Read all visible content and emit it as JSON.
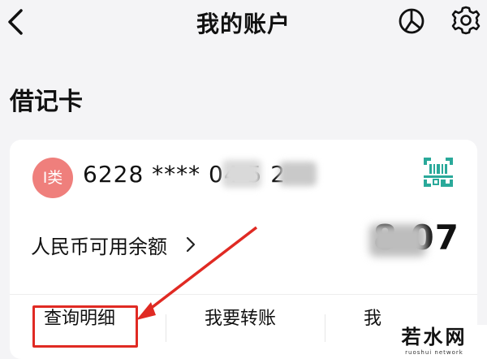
{
  "header": {
    "title": "我的账户"
  },
  "section": {
    "title": "借记卡"
  },
  "card": {
    "type_badge": "I类",
    "number_display": "6228 **** 04     5   2",
    "balance_label": "人民币可用余额",
    "balance_value": "8    07"
  },
  "actions": {
    "details": "查询明细",
    "transfer": "我要转账",
    "more": "我"
  },
  "watermark": {
    "text": "若水网",
    "sub": "ruoshui network"
  },
  "colors": {
    "accent_red": "#e02a23",
    "badge_red": "#ef7f7c",
    "qr_teal": "#2aa99a"
  },
  "icons": {
    "back": "back-chevron-icon",
    "stats": "pie-chart-icon",
    "settings": "gear-icon",
    "qr": "qr-code-icon",
    "balance_more": "chevron-right-icon"
  }
}
